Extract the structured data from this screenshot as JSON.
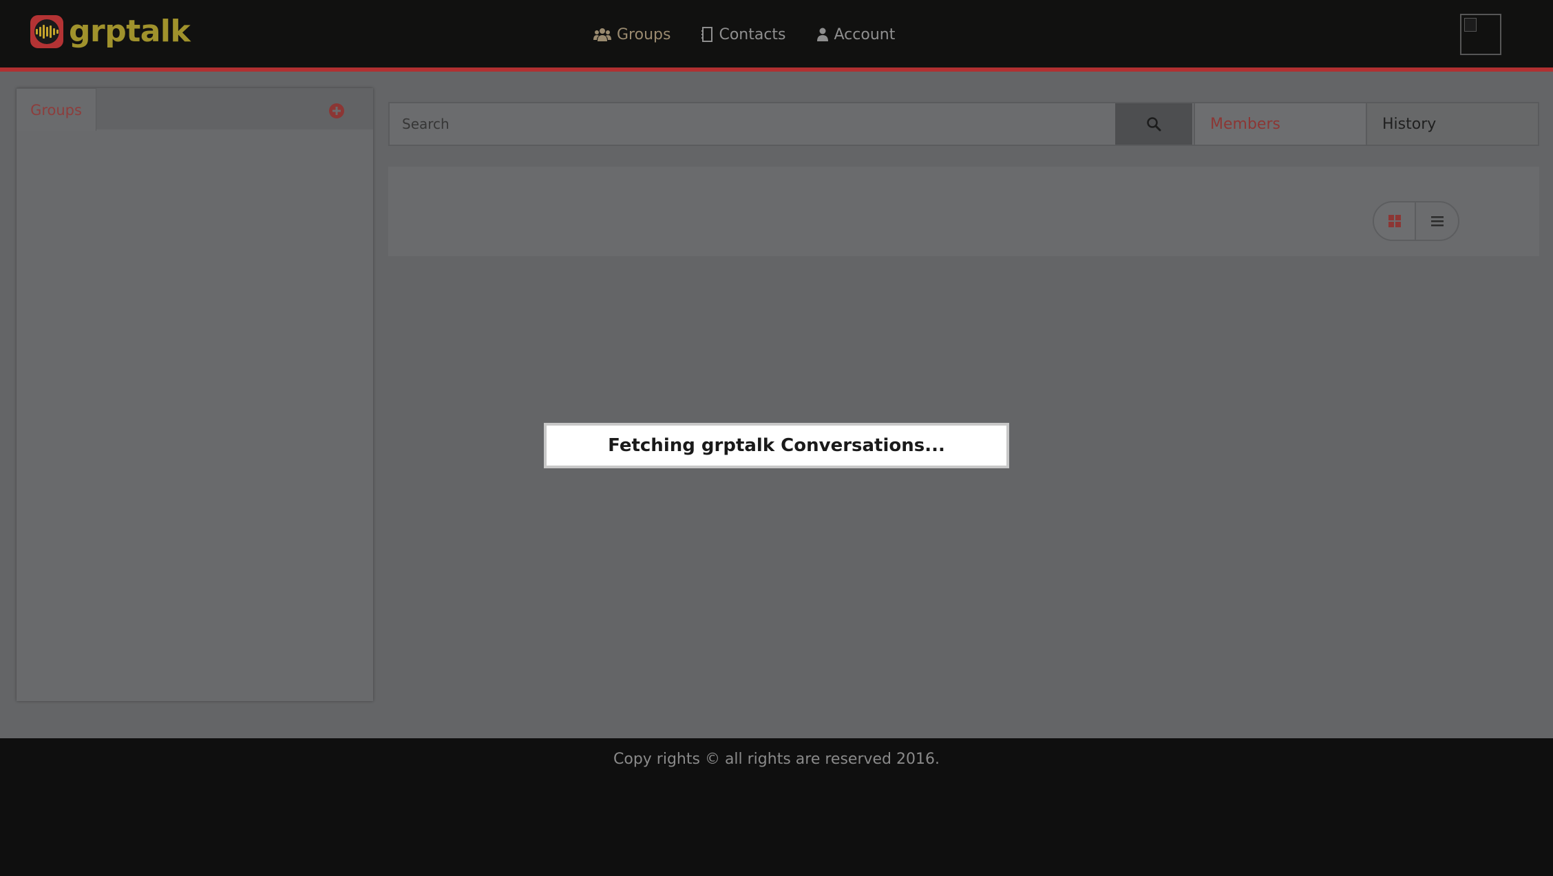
{
  "header": {
    "logo_text": "grptalk",
    "nav": [
      {
        "label": "Groups",
        "icon": "users-icon",
        "active": true
      },
      {
        "label": "Contacts",
        "icon": "address-book-icon",
        "active": false
      },
      {
        "label": "Account",
        "icon": "user-icon",
        "active": false
      }
    ]
  },
  "sidebar": {
    "tab_label": "Groups",
    "add_icon": "plus-circle-icon"
  },
  "search": {
    "placeholder": "Search",
    "button_icon": "search-icon"
  },
  "tabs": {
    "members": "Members",
    "history": "History"
  },
  "view_toggle": {
    "grid_icon": "grid-icon",
    "list_icon": "list-icon"
  },
  "loading": {
    "message": "Fetching grptalk Conversations..."
  },
  "footer": {
    "text": "Copy rights © all rights are reserved 2016."
  },
  "colors": {
    "brand_red": "#b13031",
    "brand_gold": "#a0922c",
    "header_bg": "#111110",
    "overlay_bg": "#646567"
  }
}
